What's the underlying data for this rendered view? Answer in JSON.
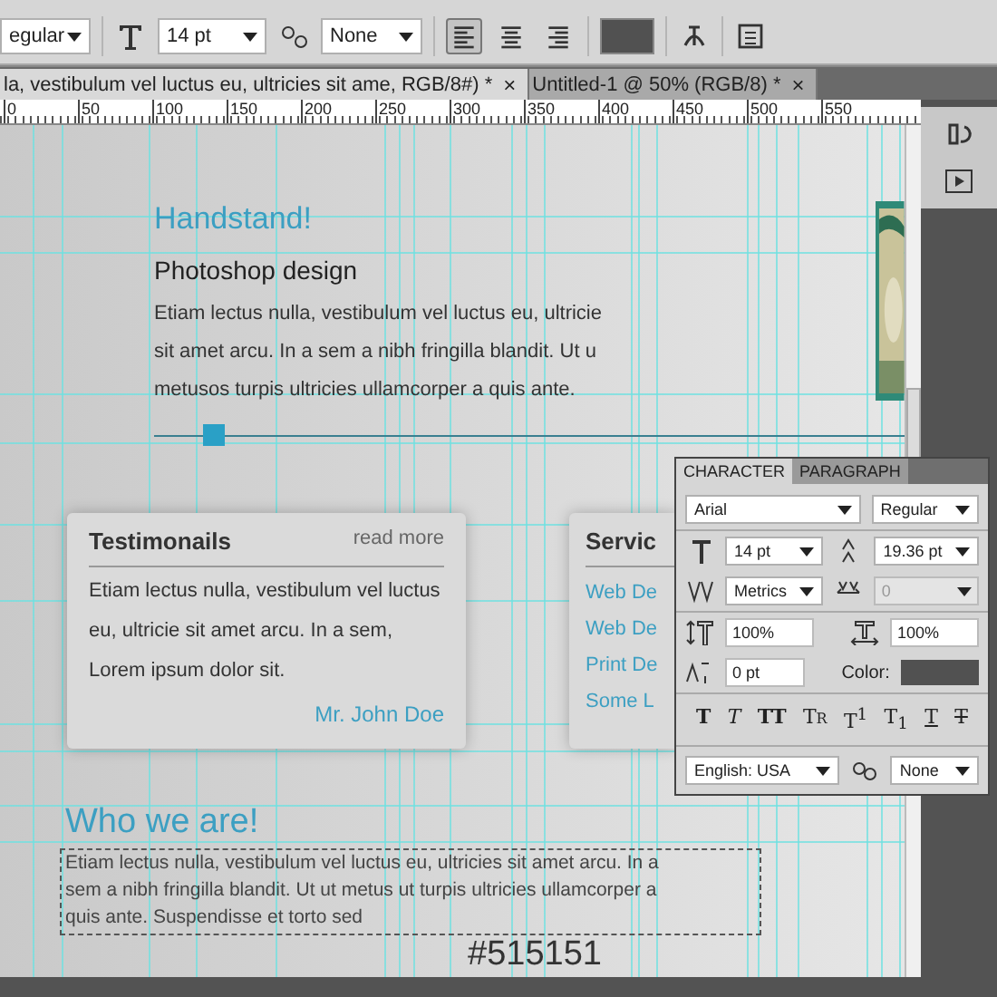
{
  "options_bar": {
    "font_style": "egular",
    "size": "14 pt",
    "antialias": "None",
    "align": [
      {
        "selected": true
      },
      {
        "selected": false
      },
      {
        "selected": false
      }
    ]
  },
  "document_tabs": [
    {
      "title": "la, vestibulum vel luctus eu, ultricies sit ame, RGB/8#) *",
      "selected": true,
      "close": "×"
    },
    {
      "title": "Untitled-1 @ 50% (RGB/8) *",
      "selected": false,
      "close": "×"
    }
  ],
  "ruler": [
    "0",
    "50",
    "100",
    "150",
    "200",
    "250",
    "300",
    "350",
    "400",
    "450",
    "500",
    "550"
  ],
  "canvas": {
    "hero": {
      "title": "Handstand!",
      "subtitle": "Photoshop design",
      "body": "Etiam lectus nulla, vestibulum vel luctus eu, ultricie\nsit amet arcu. In a sem a nibh fringilla blandit. Ut u\nmetusos turpis ultricies ullamcorper a quis ante."
    },
    "testimonials": {
      "title": "Testimonails",
      "link": "read more",
      "body": "Etiam lectus nulla, vestibulum vel luctus\neu, ultricie sit amet arcu. In a sem,\nLorem ipsum dolor sit.",
      "author": "Mr. John Doe"
    },
    "services": {
      "title": "Servic",
      "links": [
        "Web De",
        "Web De",
        "Print De",
        "Some L"
      ]
    },
    "about": {
      "title": "Who we are!",
      "body": "Etiam lectus nulla, vestibulum vel luctus eu, ultricies sit amet arcu. In a\nsem a nibh fringilla blandit. Ut ut metus ut turpis ultricies ullamcorper a\nquis ante. Suspendisse et torto sed"
    },
    "color_label": "#515151"
  },
  "character_panel": {
    "tabs": [
      {
        "label": "CHARACTER",
        "selected": true
      },
      {
        "label": "PARAGRAPH",
        "selected": false
      }
    ],
    "font": "Arial",
    "style": "Regular",
    "size": "14 pt",
    "leading": "19.36 pt",
    "kerning": "Metrics",
    "tracking": "0",
    "tracking_disabled": true,
    "vertical_scale": "100%",
    "horizontal_scale": "100%",
    "baseline": "0 pt",
    "color_label": "Color:",
    "styles": [
      {
        "kind": "bold",
        "glyph": "T"
      },
      {
        "kind": "italic",
        "glyph": "T"
      },
      {
        "kind": "caps",
        "glyph": "TT"
      },
      {
        "kind": "smallcaps",
        "glyph": "Tr"
      },
      {
        "kind": "super",
        "glyph": "T$^{1}$"
      },
      {
        "kind": "sub",
        "glyph": "T$_{1}$"
      },
      {
        "kind": "underline",
        "glyph": "T"
      },
      {
        "kind": "strike",
        "glyph": "T"
      }
    ],
    "language": "English: USA",
    "antialias": "None"
  }
}
